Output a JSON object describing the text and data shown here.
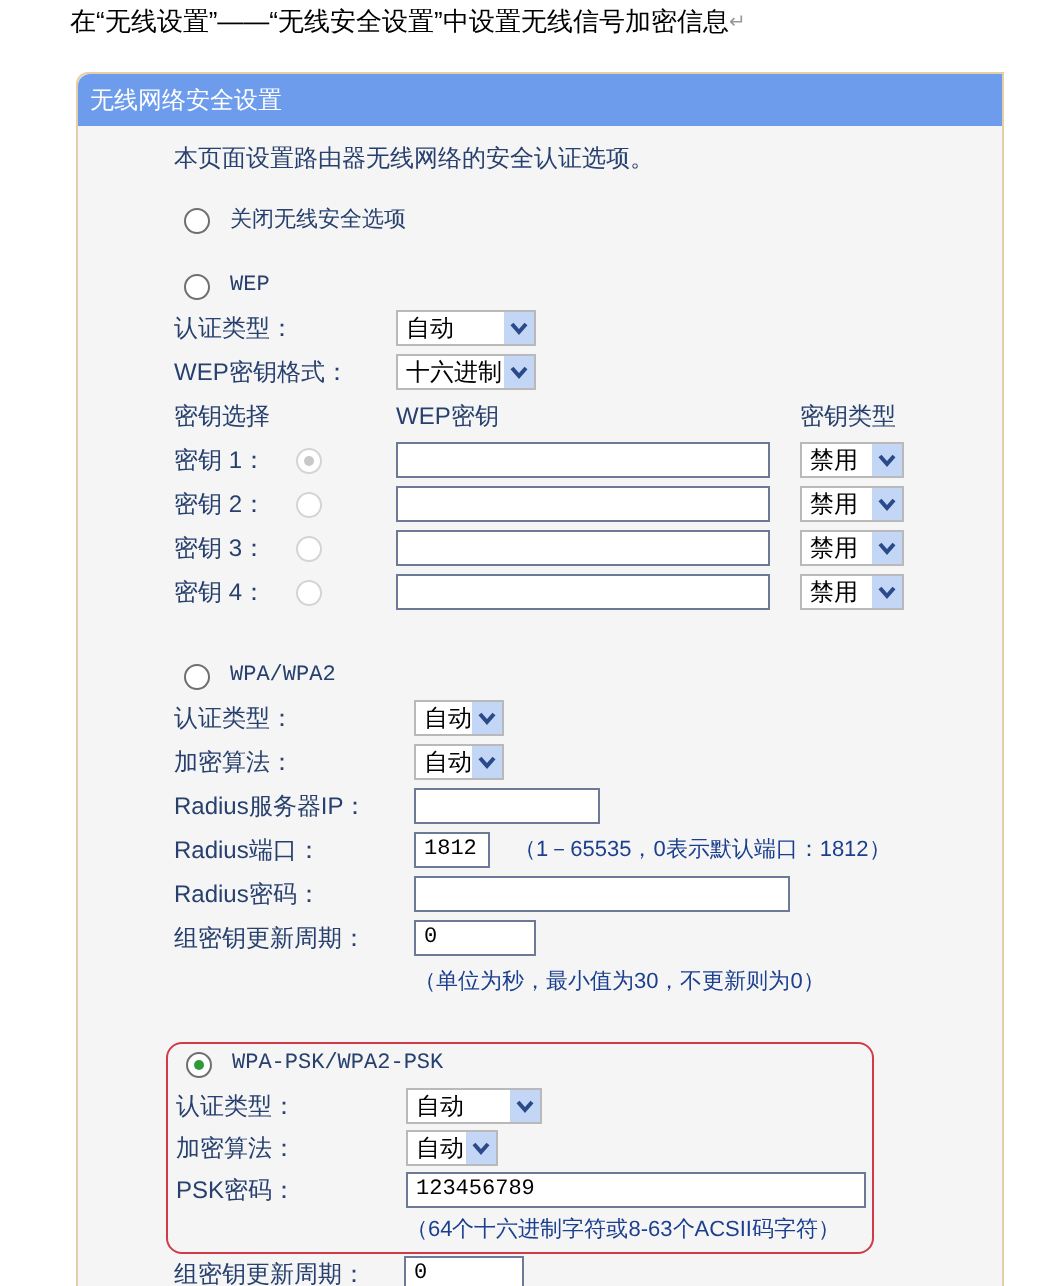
{
  "heading": "在“无线设置”——“无线安全设置”中设置无线信号加密信息",
  "heading_mark": "↵",
  "panel": {
    "title": "无线网络安全设置",
    "description": "本页面设置路由器无线网络的安全认证选项。",
    "options": [
      {
        "kind": "none",
        "label": "关闭无线安全选项",
        "selected": false,
        "highlighted": false
      },
      {
        "kind": "wep",
        "label": "WEP",
        "selected": false,
        "highlighted": false,
        "rows": [
          {
            "kind": "select",
            "label": "认证类型：",
            "value": "自动"
          },
          {
            "kind": "select",
            "label": "WEP密钥格式：",
            "value": "十六进制"
          },
          {
            "kind": "key_header",
            "columns": [
              "密钥选择",
              "WEP密钥",
              "密钥类型"
            ]
          },
          {
            "kind": "key",
            "label": "密钥 1：",
            "selected": true,
            "disabled": true,
            "value": "",
            "type": "禁用"
          },
          {
            "kind": "key",
            "label": "密钥 2：",
            "selected": false,
            "disabled": true,
            "value": "",
            "type": "禁用"
          },
          {
            "kind": "key",
            "label": "密钥 3：",
            "selected": false,
            "disabled": true,
            "value": "",
            "type": "禁用"
          },
          {
            "kind": "key",
            "label": "密钥 4：",
            "selected": false,
            "disabled": true,
            "value": "",
            "type": "禁用"
          }
        ]
      },
      {
        "kind": "wpa",
        "label": "WPA/WPA2",
        "selected": false,
        "highlighted": false,
        "rows": [
          {
            "kind": "select",
            "label": "认证类型：",
            "value": "自动"
          },
          {
            "kind": "select",
            "label": "加密算法：",
            "value": "自动"
          },
          {
            "kind": "input",
            "label": "Radius服务器IP：",
            "value": ""
          },
          {
            "kind": "input",
            "label": "Radius端口：",
            "value": "1812",
            "hint": "（1－65535，0表示默认端口：1812）"
          },
          {
            "kind": "input",
            "label": "Radius密码：",
            "value": ""
          },
          {
            "kind": "input",
            "label": "组密钥更新周期：",
            "value": "0"
          },
          {
            "kind": "hint",
            "text": "（单位为秒，最小值为30，不更新则为0）"
          }
        ]
      },
      {
        "kind": "psk",
        "label": "WPA-PSK/WPA2-PSK",
        "selected": true,
        "highlighted": true,
        "rows": [
          {
            "kind": "select",
            "label": "认证类型：",
            "value": "自动"
          },
          {
            "kind": "select",
            "label": "加密算法：",
            "value": "自动"
          },
          {
            "kind": "input",
            "label": "PSK密码：",
            "value": "123456789"
          },
          {
            "kind": "hint",
            "text": "（64个十六进制字符或8-63个ACSII码字符）"
          }
        ],
        "rows_below_highlight": [
          {
            "kind": "input",
            "label": "组密钥更新周期：",
            "value": "0"
          }
        ]
      }
    ]
  }
}
